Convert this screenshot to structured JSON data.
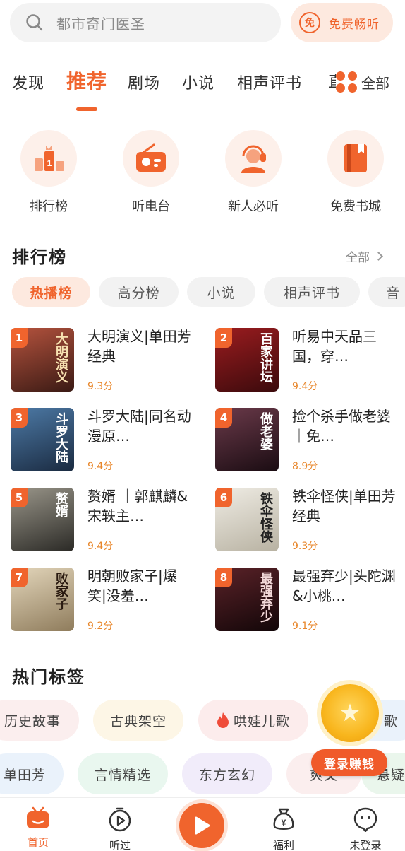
{
  "search": {
    "placeholder": "都市奇门医圣",
    "free_label": "免费畅听",
    "free_icon_text": "免"
  },
  "tabs": [
    {
      "label": "发现"
    },
    {
      "label": "推荐"
    },
    {
      "label": "剧场"
    },
    {
      "label": "小说"
    },
    {
      "label": "相声评书"
    }
  ],
  "tab_clipped": "直",
  "all_tab": "全部",
  "quick_entries": [
    {
      "label": "排行榜",
      "icon": "podium-icon"
    },
    {
      "label": "听电台",
      "icon": "radio-icon"
    },
    {
      "label": "新人必听",
      "icon": "headset-person-icon"
    },
    {
      "label": "免费书城",
      "icon": "book-icon"
    }
  ],
  "ranking": {
    "title": "排行榜",
    "more": "全部",
    "pills": [
      "热播榜",
      "高分榜",
      "小说",
      "相声评书",
      "音"
    ],
    "items": [
      {
        "rank": "1",
        "title": "大明演义|单田芳经典",
        "score": "9.3分",
        "cover_text": "大明演义",
        "cover_color": "#8a3a2a"
      },
      {
        "rank": "2",
        "title": "听易中天品三国，穿…",
        "score": "9.4分",
        "cover_text": "百家讲坛",
        "cover_color": "#7a1518"
      },
      {
        "rank": "3",
        "title": "斗罗大陆|同名动漫原…",
        "score": "9.4分",
        "cover_text": "斗罗大陆",
        "cover_color": "#2c4a6a"
      },
      {
        "rank": "4",
        "title": "捡个杀手做老婆｜免…",
        "score": "8.9分",
        "cover_text": "做老婆",
        "cover_color": "#3a2030"
      },
      {
        "rank": "5",
        "title": "赘婿 ｜郭麒麟&宋轶主…",
        "score": "9.4分",
        "cover_text": "赘婿",
        "cover_color": "#5d5a52"
      },
      {
        "rank": "6",
        "title": "铁伞怪侠|单田芳经典",
        "score": "9.3分",
        "cover_text": "铁伞怪侠",
        "cover_color": "#d9d4c6"
      },
      {
        "rank": "7",
        "title": "明朝败家子|爆笑|没羞…",
        "score": "9.2分",
        "cover_text": "败家子",
        "cover_color": "#c9b89a"
      },
      {
        "rank": "8",
        "title": "最强弃少|头陀渊&小桃…",
        "score": "9.1分",
        "cover_text": "最强弃少",
        "cover_color": "#2a1518"
      }
    ]
  },
  "hot_tags": {
    "title": "热门标签",
    "row1": [
      {
        "label": "历史故事",
        "bg": "#fbeeee"
      },
      {
        "label": "古典架空",
        "bg": "#fdf6e6"
      },
      {
        "label": "哄娃儿歌",
        "bg": "#fcecec",
        "icon": "fire-icon"
      },
      {
        "label": "歌",
        "bg": "#eaf2fb"
      }
    ],
    "row2": [
      {
        "label": "单田芳",
        "bg": "#eaf2fb"
      },
      {
        "label": "言情精选",
        "bg": "#e9f7ef"
      },
      {
        "label": "东方玄幻",
        "bg": "#f1ecfa"
      },
      {
        "label": "爽文",
        "bg": "#fbeeee"
      },
      {
        "label": "悬疑",
        "bg": "#eaf6ec"
      }
    ]
  },
  "floating": {
    "label": "登录赚钱"
  },
  "bottom_nav": [
    {
      "label": "首页",
      "icon": "home-tv-icon"
    },
    {
      "label": "听过",
      "icon": "history-play-icon"
    },
    {
      "label": "福利",
      "icon": "money-bag-icon"
    },
    {
      "label": "未登录",
      "icon": "chat-face-icon"
    }
  ],
  "colors": {
    "accent": "#f0642d",
    "score": "#e8862a"
  }
}
